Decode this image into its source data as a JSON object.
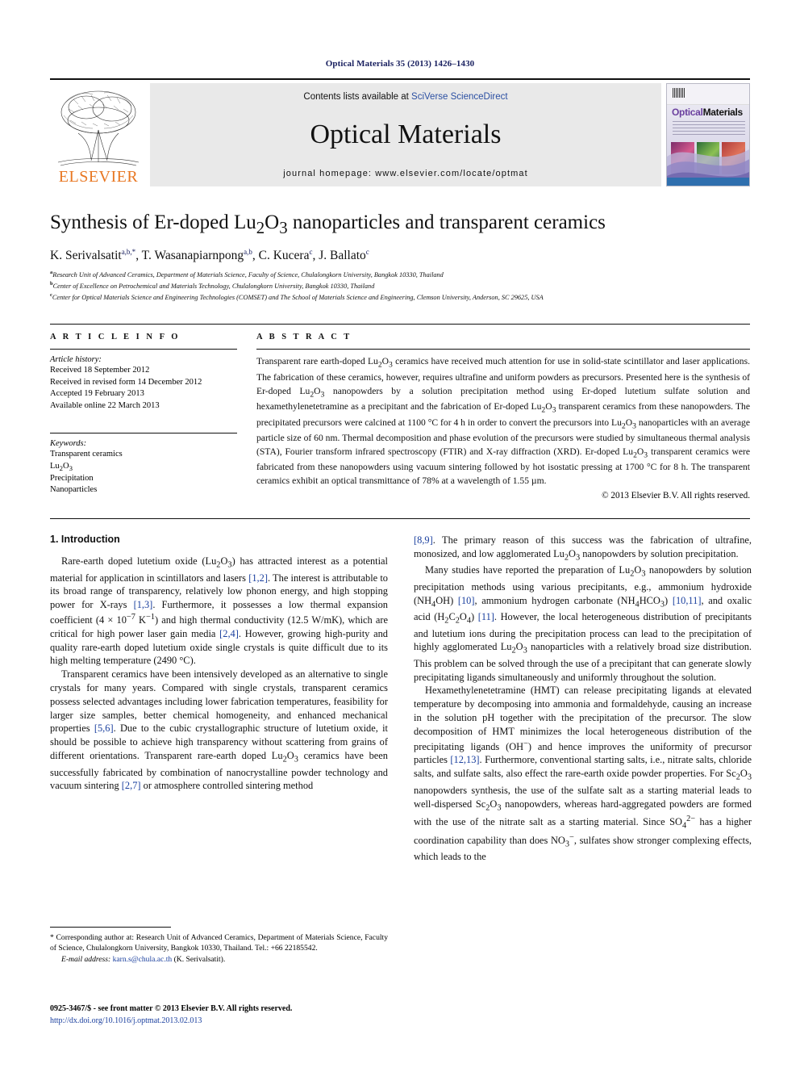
{
  "running_head": "Optical Materials 35 (2013) 1426–1430",
  "masthead": {
    "contents_prefix": "Contents lists available at ",
    "contents_link": "SciVerse ScienceDirect",
    "journal_title": "Optical Materials",
    "homepage": "journal homepage: www.elsevier.com/locate/optmat",
    "publisher": "ELSEVIER",
    "cover_title_a": "Optical",
    "cover_title_b": "Materials"
  },
  "title": "Synthesis of Er-doped Lu2O3 nanoparticles and transparent ceramics",
  "authors": [
    {
      "name": "K. Serivalsatit",
      "sup": "a,b,*"
    },
    {
      "name": "T. Wasanapiarnpong",
      "sup": "a,b"
    },
    {
      "name": "C. Kucera",
      "sup": "c"
    },
    {
      "name": "J. Ballato",
      "sup": "c"
    }
  ],
  "affiliations": [
    {
      "mark": "a",
      "text": "Research Unit of Advanced Ceramics, Department of Materials Science, Faculty of Science, Chulalongkorn University, Bangkok 10330, Thailand"
    },
    {
      "mark": "b",
      "text": "Center of Excellence on Petrochemical and Materials Technology, Chulalongkorn University, Bangkok 10330, Thailand"
    },
    {
      "mark": "c",
      "text": "Center for Optical Materials Science and Engineering Technologies (COMSET) and The School of Materials Science and Engineering, Clemson University, Anderson, SC 29625, USA"
    }
  ],
  "article_info": {
    "heading": "A R T I C L E    I N F O",
    "history_title": "Article history:",
    "history": [
      "Received 18 September 2012",
      "Received in revised form 14 December 2012",
      "Accepted 19 February 2013",
      "Available online 22 March 2013"
    ],
    "keywords_title": "Keywords:",
    "keywords": [
      "Transparent ceramics",
      "Lu2O3",
      "Precipitation",
      "Nanoparticles"
    ]
  },
  "abstract": {
    "heading": "A B S T R A C T",
    "text": "Transparent rare earth-doped Lu2O3 ceramics have received much attention for use in solid-state scintillator and laser applications. The fabrication of these ceramics, however, requires ultrafine and uniform powders as precursors. Presented here is the synthesis of Er-doped Lu2O3 nanopowders by a solution precipitation method using Er-doped lutetium sulfate solution and hexamethylenetetramine as a precipitant and the fabrication of Er-doped Lu2O3 transparent ceramics from these nanopowders. The precipitated precursors were calcined at 1100 °C for 4 h in order to convert the precursors into Lu2O3 nanoparticles with an average particle size of 60 nm. Thermal decomposition and phase evolution of the precursors were studied by simultaneous thermal analysis (STA), Fourier transform infrared spectroscopy (FTIR) and X-ray diffraction (XRD). Er-doped Lu2O3 transparent ceramics were fabricated from these nanopowders using vacuum sintering followed by hot isostatic pressing at 1700 °C for 8 h. The transparent ceramics exhibit an optical transmittance of 78% at a wavelength of 1.55 µm.",
    "copyright": "© 2013 Elsevier B.V. All rights reserved."
  },
  "section": {
    "number_title": "1. Introduction",
    "left_paragraphs": [
      "Rare-earth doped lutetium oxide (Lu2O3) has attracted interest as a potential material for application in scintillators and lasers [1,2]. The interest is attributable to its broad range of transparency, relatively low phonon energy, and high stopping power for X-rays [1,3]. Furthermore, it possesses a low thermal expansion coefficient (4 × 10−7 K−1) and high thermal conductivity (12.5 W/mK), which are critical for high power laser gain media [2,4]. However, growing high-purity and quality rare-earth doped lutetium oxide single crystals is quite difficult due to its high melting temperature (2490 °C).",
      "Transparent ceramics have been intensively developed as an alternative to single crystals for many years. Compared with single crystals, transparent ceramics possess selected advantages including lower fabrication temperatures, feasibility for larger size samples, better chemical homogeneity, and enhanced mechanical properties [5,6]. Due to the cubic crystallographic structure of lutetium oxide, it should be possible to achieve high transparency without scattering from grains of different orientations. Transparent rare-earth doped Lu2O3 ceramics have been successfully fabricated by combination of nanocrystalline powder technology and vacuum sintering [2,7] or atmosphere controlled sintering method"
    ],
    "right_paragraphs": [
      "[8,9]. The primary reason of this success was the fabrication of ultrafine, monosized, and low agglomerated Lu2O3 nanopowders by solution precipitation.",
      "Many studies have reported the preparation of Lu2O3 nanopowders by solution precipitation methods using various precipitants, e.g., ammonium hydroxide (NH4OH) [10], ammonium hydrogen carbonate (NH4HCO3) [10,11], and oxalic acid (H2C2O4) [11]. However, the local heterogeneous distribution of precipitants and lutetium ions during the precipitation process can lead to the precipitation of highly agglomerated Lu2O3 nanoparticles with a relatively broad size distribution. This problem can be solved through the use of a precipitant that can generate slowly precipitating ligands simultaneously and uniformly throughout the solution.",
      "Hexamethylenetetramine (HMT) can release precipitating ligands at elevated temperature by decomposing into ammonia and formaldehyde, causing an increase in the solution pH together with the precipitation of the precursor. The slow decomposition of HMT minimizes the local heterogeneous distribution of the precipitating ligands (OH−) and hence improves the uniformity of precursor particles [12,13]. Furthermore, conventional starting salts, i.e., nitrate salts, chloride salts, and sulfate salts, also effect the rare-earth oxide powder properties. For Sc2O3 nanopowders synthesis, the use of the sulfate salt as a starting material leads to well-dispersed Sc2O3 nanopowders, whereas hard-aggregated powders are formed with the use of the nitrate salt as a starting material. Since SO42− has a higher coordination capability than does NO3−, sulfates show stronger complexing effects, which leads to the"
    ]
  },
  "footnotes": {
    "corresponding": "* Corresponding author at: Research Unit of Advanced Ceramics, Department of Materials Science, Faculty of Science, Chulalongkorn University, Bangkok 10330, Thailand. Tel.: +66 22185542.",
    "email_label": "E-mail address:",
    "email": "karn.s@chula.ac.th",
    "email_suffix": "(K. Serivalsatit)."
  },
  "footer": {
    "issn_line": "0925-3467/$ - see front matter © 2013 Elsevier B.V. All rights reserved.",
    "doi": "http://dx.doi.org/10.1016/j.optmat.2013.02.013"
  }
}
